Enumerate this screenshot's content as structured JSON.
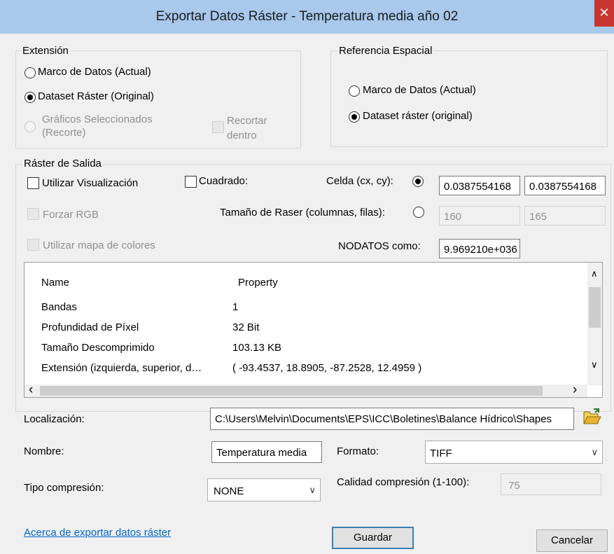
{
  "window": {
    "title": "Exportar Datos Ráster - Temperatura media año 02",
    "close_glyph": "✕"
  },
  "extension": {
    "legend": "Extensión",
    "opt_marco": "Marco de Datos (Actual)",
    "opt_dataset": "Dataset Ráster (Original)",
    "opt_graficos_1": "Gráficos Seleccionados",
    "opt_graficos_2": "(Recorte)",
    "recortar_1": "Recortar",
    "recortar_2": "dentro"
  },
  "spatial_ref": {
    "legend": "Referencia Espacial",
    "opt_marco": "Marco de Datos (Actual)",
    "opt_dataset": "Dataset ráster (original)"
  },
  "output": {
    "legend": "Ráster de Salida",
    "utilizar_visualizacion": "Utilizar Visualización",
    "cuadrado": "Cuadrado:",
    "celda_label": "Celda (cx, cy):",
    "celda_cx": "0.0387554168",
    "celda_cy": "0.0387554168",
    "forzar_rgb": "Forzar RGB",
    "tamano_label": "Tamaño de Raser (columnas, filas):",
    "columnas": "160",
    "filas": "165",
    "mapa_colores": "Utilizar mapa de colores",
    "nodatos_label": "NODATOS como:",
    "nodatos_value": "9.969210e+036"
  },
  "props": {
    "col_name": "Name",
    "col_property": "Property",
    "rows": [
      {
        "name": "Bandas",
        "value": "1"
      },
      {
        "name": "Profundidad de Píxel",
        "value": "32 Bit"
      },
      {
        "name": "Tamaño Descomprimido",
        "value": "103.13 KB"
      },
      {
        "name": "Extensión (izquierda, superior, d…",
        "value": "( -93.4537, 18.8905, -87.2528, 12.4959 )"
      }
    ],
    "arrows": {
      "up": "∧",
      "down": "∨",
      "left": "‹",
      "right": "›"
    }
  },
  "form": {
    "localizacion_label": "Localización:",
    "localizacion_value": "C:\\Users\\Melvin\\Documents\\EPS\\ICC\\Boletines\\Balance Hídrico\\Shapes",
    "nombre_label": "Nombre:",
    "nombre_value": "Temperatura media",
    "formato_label": "Formato:",
    "formato_value": "TIFF",
    "tipo_label": "Tipo compresión:",
    "tipo_value": "NONE",
    "calidad_label": "Calidad compresión (1-100):",
    "calidad_value": "75",
    "select_arrow": "∨"
  },
  "footer": {
    "link": "Acerca de exportar datos ráster",
    "guardar": "Guardar",
    "cancelar": "Cancelar"
  },
  "colors": {
    "titlebar": "#a8c8ec",
    "close": "#c7372f",
    "link": "#0066cc",
    "folder_icon": "#e8b530"
  },
  "icons": {
    "folder": "folder-open-icon",
    "close": "close-icon"
  }
}
